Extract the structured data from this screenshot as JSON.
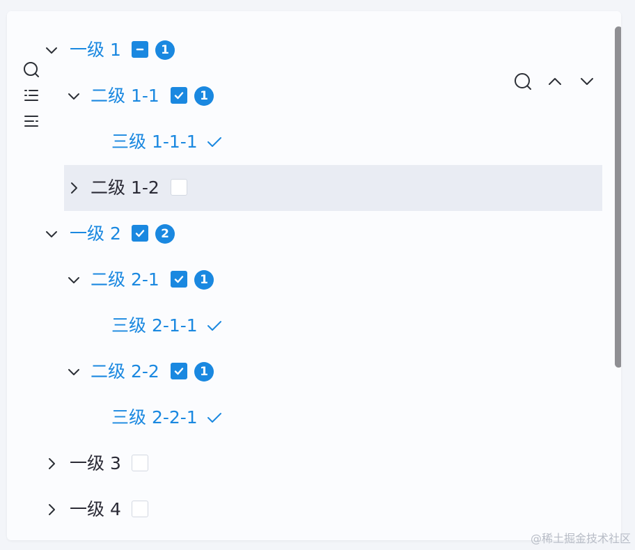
{
  "colors": {
    "accent": "#1a88e0",
    "text": "#2a2a35",
    "highlight_row": "#e9ecf3",
    "scrollbar": "#8f8f93"
  },
  "toolbar": {
    "side_icons": [
      "search-icon",
      "list-ordered-icon",
      "list-indent-icon"
    ],
    "top_icons": [
      "search-icon",
      "chevron-up-icon",
      "chevron-down-icon"
    ]
  },
  "tree": [
    {
      "label": "一级 1",
      "level": 1,
      "expanded": true,
      "state": "partial",
      "badge": "1",
      "active": true,
      "highlighted": false
    },
    {
      "label": "二级 1-1",
      "level": 2,
      "expanded": true,
      "state": "checked",
      "badge": "1",
      "active": true,
      "highlighted": false
    },
    {
      "label": "三级 1-1-1",
      "level": 3,
      "leaf": true,
      "state": "selected",
      "active": true,
      "highlighted": false
    },
    {
      "label": "二级 1-2",
      "level": 2,
      "expanded": false,
      "state": "unchecked",
      "active": false,
      "highlighted": true
    },
    {
      "label": "一级 2",
      "level": 1,
      "expanded": true,
      "state": "checked",
      "badge": "2",
      "active": true,
      "highlighted": false
    },
    {
      "label": "二级 2-1",
      "level": 2,
      "expanded": true,
      "state": "checked",
      "badge": "1",
      "active": true,
      "highlighted": false
    },
    {
      "label": "三级 2-1-1",
      "level": 3,
      "leaf": true,
      "state": "selected",
      "active": true,
      "highlighted": false
    },
    {
      "label": "二级 2-2",
      "level": 2,
      "expanded": true,
      "state": "checked",
      "badge": "1",
      "active": true,
      "highlighted": false
    },
    {
      "label": "三级 2-2-1",
      "level": 3,
      "leaf": true,
      "state": "selected",
      "active": true,
      "highlighted": false
    },
    {
      "label": "一级 3",
      "level": 1,
      "expanded": false,
      "state": "unchecked",
      "active": false,
      "highlighted": false
    },
    {
      "label": "一级 4",
      "level": 1,
      "expanded": false,
      "state": "unchecked",
      "active": false,
      "highlighted": false
    }
  ],
  "watermark": "@稀土掘金技术社区"
}
